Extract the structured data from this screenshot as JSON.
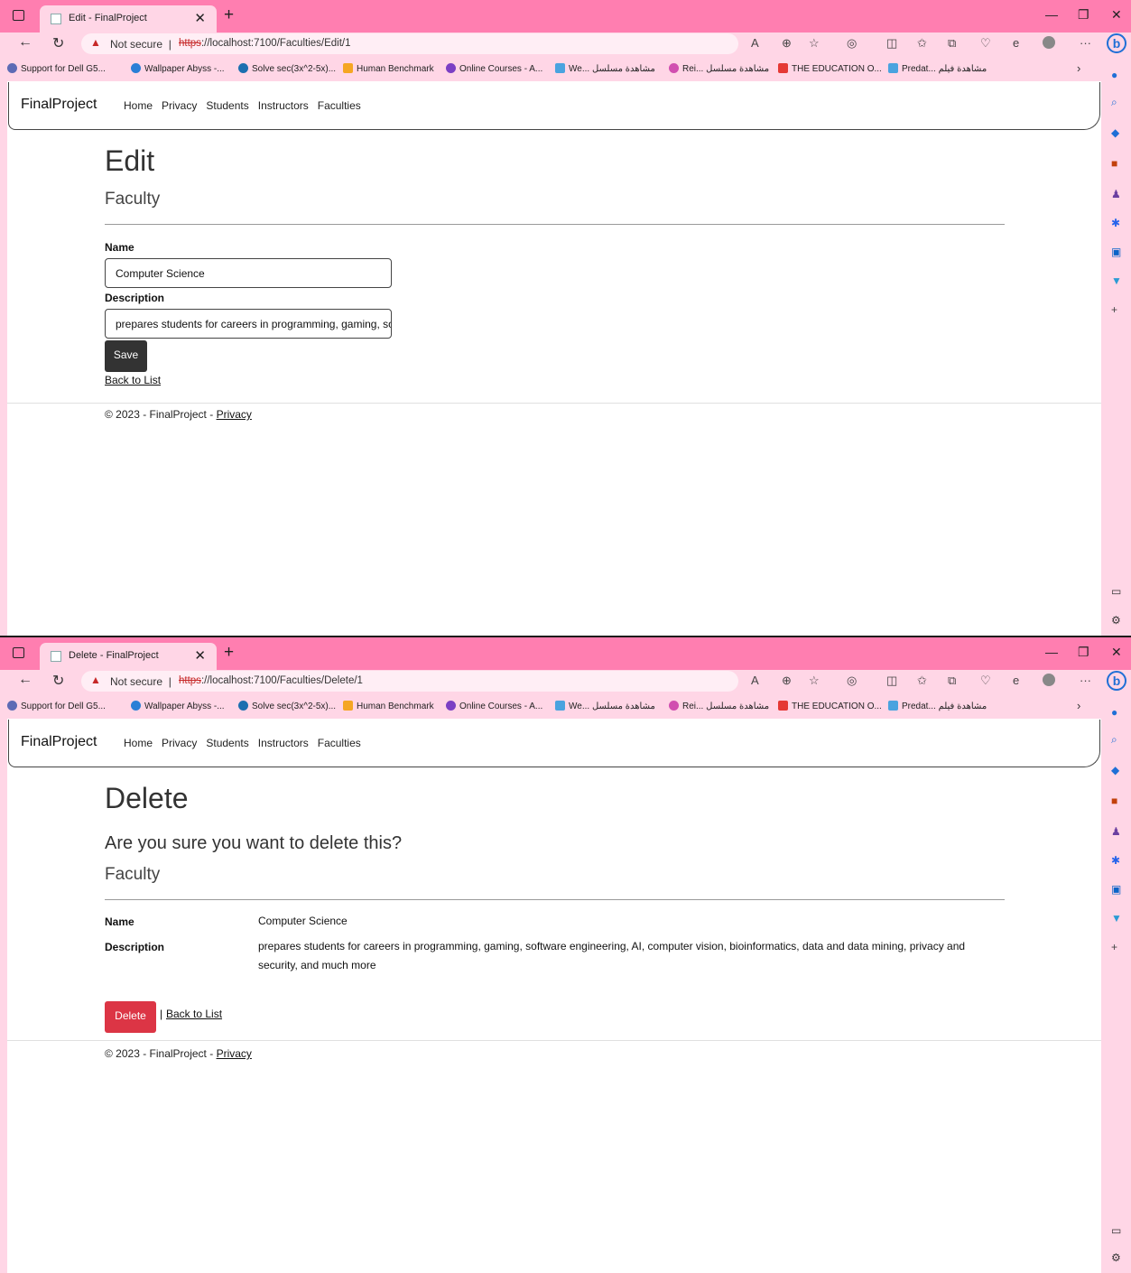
{
  "browser": {
    "not_secure": "Not secure",
    "url_scheme": "https",
    "url_rest": "://localhost:7100/Faculties/",
    "bookmarks": [
      "Support for Dell G5...",
      "Wallpaper Abyss -...",
      "Solve sec(3x^2-5x)...",
      "Human Benchmark",
      "Online Courses - A...",
      "We... مشاهدة مسلسل",
      "Rei... مشاهدة مسلسل",
      "THE EDUCATION O...",
      "Predat... مشاهدة فيلم"
    ],
    "bookmark_colors": [
      "#5d6bb5",
      "#2a7fd6",
      "#1c6fb0",
      "#f5a623",
      "#7b3fc4",
      "#4aa3df",
      "#d14fb0",
      "#e53935",
      "#4aa3df"
    ]
  },
  "site": {
    "brand": "FinalProject",
    "nav": [
      "Home",
      "Privacy",
      "Students",
      "Instructors",
      "Faculties"
    ],
    "footer_text": "© 2023 - FinalProject - ",
    "footer_link": "Privacy"
  },
  "edit": {
    "tab_title": "Edit - FinalProject",
    "url_path": "Edit/1",
    "heading": "Edit",
    "subheading": "Faculty",
    "name_label": "Name",
    "name_value": "Computer Science",
    "description_label": "Description",
    "description_value": "prepares students for careers in programming, gaming, software engineering, AI, computer vision, bioinformatics, data and data mining, privacy and security, and much more",
    "save_label": "Save",
    "back_label": "Back to List"
  },
  "delete": {
    "tab_title": "Delete - FinalProject",
    "url_path": "Delete/1",
    "heading": "Delete",
    "question": "Are you sure you want to delete this?",
    "subheading": "Faculty",
    "name_label": "Name",
    "name_value": "Computer Science",
    "description_label": "Description",
    "description_value": "prepares students for careers in programming, gaming, software engineering, AI, computer vision, bioinformatics, data and data mining, privacy and security, and much more",
    "delete_label": "Delete",
    "separator": "|",
    "back_label": "Back to List"
  }
}
